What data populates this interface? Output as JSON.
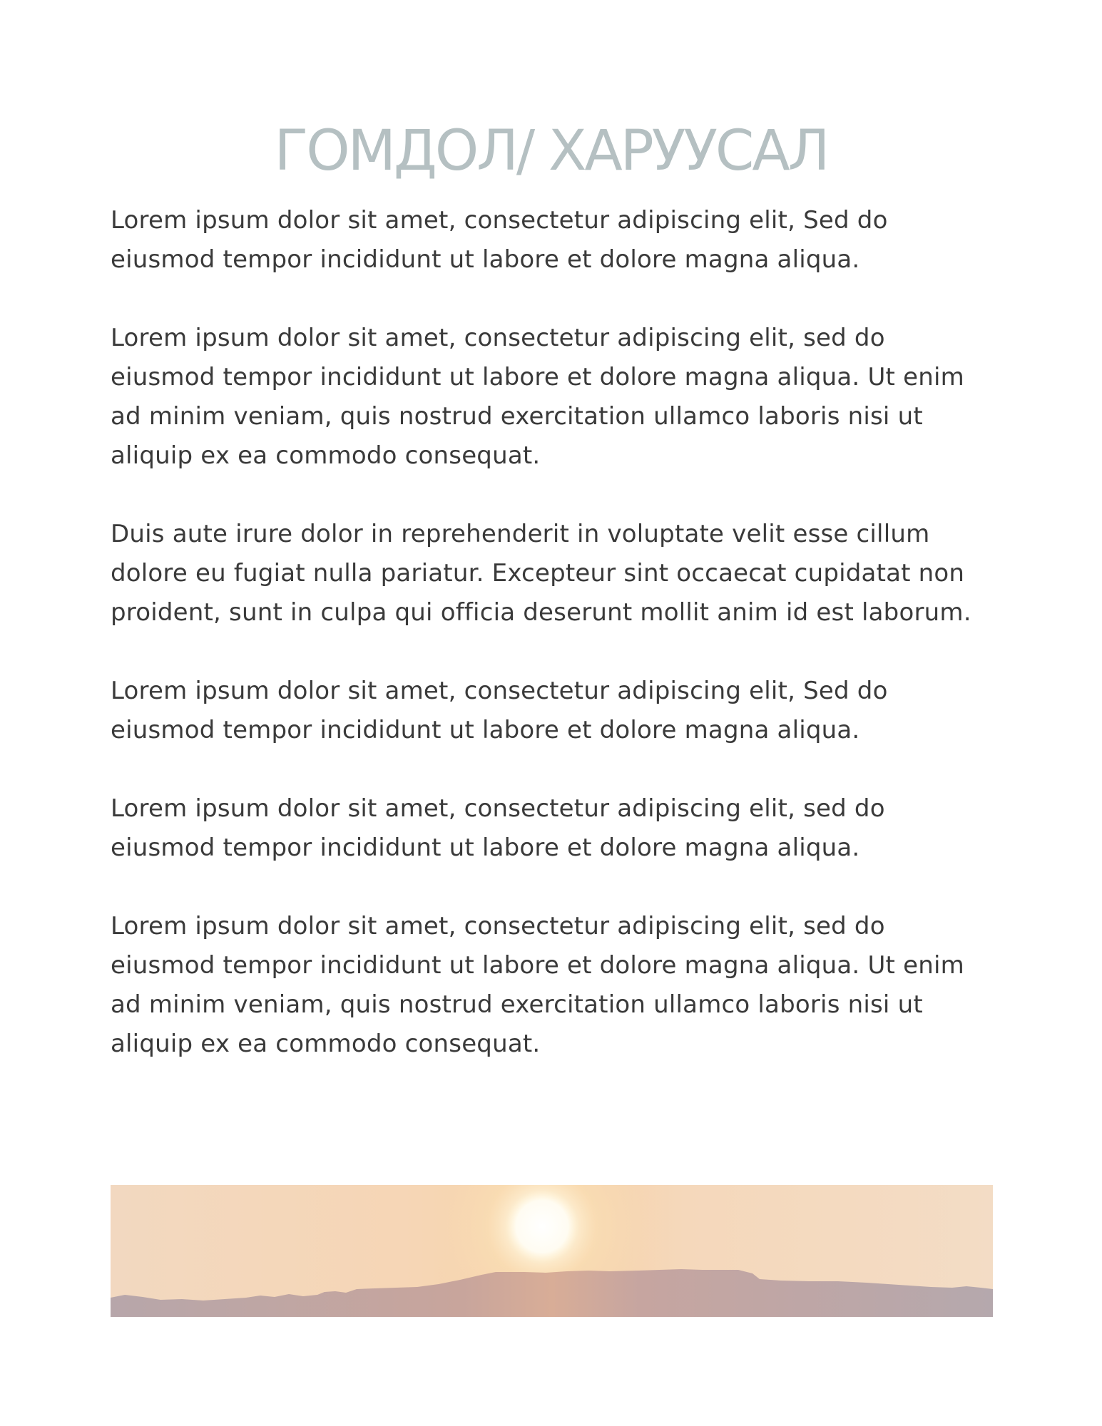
{
  "document": {
    "title": "ГОМДОЛ/ ХАРУУСАЛ",
    "paragraphs": [
      "Lorem ipsum dolor sit amet, consectetur adipiscing elit, Sed do eiusmod tempor incididunt ut labore et dolore magna aliqua.",
      "Lorem ipsum dolor sit amet, consectetur adipiscing elit, sed do eiusmod tempor incididunt ut labore et dolore magna aliqua. Ut enim ad minim veniam, quis nostrud exercitation ullamco laboris nisi ut aliquip ex ea commodo consequat.",
      "Duis aute irure dolor in reprehenderit in voluptate velit esse cillum dolore eu fugiat nulla pariatur. Excepteur sint occaecat cupidatat non proident, sunt in culpa qui officia deserunt mollit anim id est laborum.",
      "Lorem ipsum dolor sit amet, consectetur adipiscing elit, Sed do eiusmod tempor incididunt ut labore et dolore magna aliqua.",
      "Lorem ipsum dolor sit amet, consectetur adipiscing elit, sed do eiusmod tempor incididunt ut labore et dolore magna aliqua.",
      "Lorem ipsum dolor sit amet, consectetur adipiscing elit, sed do eiusmod tempor incididunt ut labore et dolore magna aliqua. Ut enim ad minim veniam, quis nostrud exercitation ullamco laboris nisi ut aliquip ex ea commodo consequat."
    ]
  },
  "banner": {
    "icon": "sunset-landscape-image"
  },
  "colors": {
    "title": "#b5c0c2",
    "body_text": "#3a3a3a",
    "sky": "#f3dcc4",
    "sun": "#fffdf6",
    "mountains": "#b8a8aa"
  }
}
